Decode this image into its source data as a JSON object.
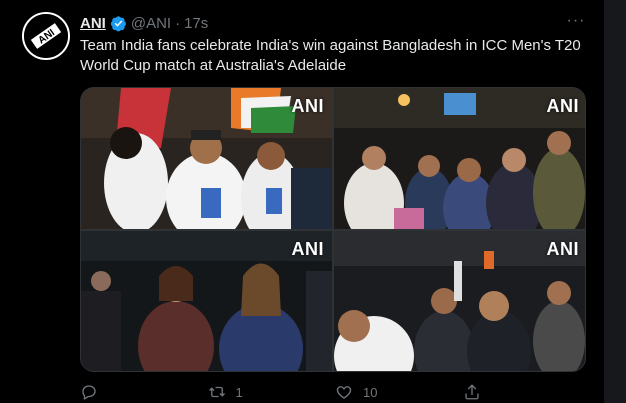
{
  "tweet": {
    "author_name": "ANI",
    "handle": "@ANI",
    "separator": "·",
    "time": "17s",
    "text": "Team India fans celebrate India's win against Bangladesh in ICC Men's T20 World Cup match at Australia's Adelaide",
    "avatar_label": "ANI"
  },
  "media": {
    "watermarks": [
      "ANI",
      "ANI",
      "ANI",
      "ANI"
    ]
  },
  "actions": {
    "reply_count": "",
    "retweet_count": "1",
    "like_count": "10"
  },
  "colors": {
    "background": "#000000",
    "text": "#e7e9ea",
    "muted": "#71767b",
    "verified": "#1d9bf0"
  },
  "icons": [
    "ani-logo-icon",
    "verified-badge-icon",
    "more-icon",
    "reply-icon",
    "retweet-icon",
    "like-icon",
    "share-icon"
  ]
}
